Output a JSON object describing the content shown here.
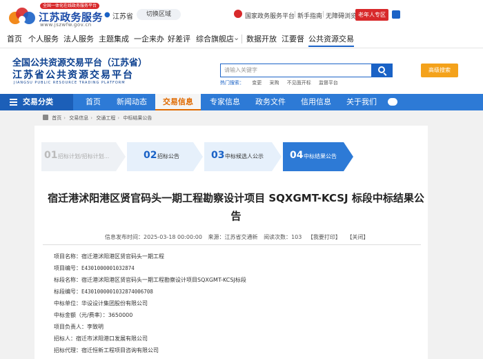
{
  "gov": {
    "site_name": "江苏政务服务",
    "slogan": "全国一体化在线政务服务平台",
    "url": "www.jszwfw.gov.cn",
    "location": "江苏省",
    "switch_region": "切换区域",
    "links": [
      "国家政务服务平台",
      "新手指南",
      "无障碍浏览"
    ],
    "elder_mode": "老年人专区",
    "nav": [
      "首页",
      "个人服务",
      "法人服务",
      "主题集成",
      "一企来办",
      "好差评",
      "综合旗舰店",
      "数据开放",
      "江要督",
      "公共资源交易"
    ],
    "nav_active": "公共资源交易"
  },
  "header": {
    "title_line1": "全国公共资源交易平台（江苏省）",
    "title_line2": "江苏省公共资源交易平台",
    "title_en": "JIANGSU PUBLIC RESOURCE TRADING PLATFORM",
    "search_placeholder": "请输入关键字",
    "hot_label": "热门搜索：",
    "hot_words": [
      "变更",
      "采购",
      "不见面开标",
      "监督平台"
    ],
    "adv_search": "高级搜索"
  },
  "mainnav": {
    "category": "交易分类",
    "items": [
      "首页",
      "新闻动态",
      "交易信息",
      "专家信息",
      "政务文件",
      "信用信息",
      "关于我们"
    ],
    "active": "交易信息"
  },
  "breadcrumb": [
    "首页",
    "交易信息",
    "交通工程",
    "中标结果公告"
  ],
  "steps": [
    {
      "num": "01",
      "label": "招标计划/招标计划..."
    },
    {
      "num": "02",
      "label": "招标公告"
    },
    {
      "num": "03",
      "label": "中标候选人公示"
    },
    {
      "num": "04",
      "label": "中标结果公告"
    }
  ],
  "article": {
    "title": "宿迁港沭阳港区贤官码头一期工程勘察设计项目 SQXGMT-KCSJ 标段中标结果公告",
    "publish_label": "信息发布时间：",
    "publish_time": "2025-03-18 00:00:00",
    "source_label": "来源：",
    "source": "江苏省交通新",
    "views_label": "阅读次数：",
    "views": "103",
    "print": "【我要打印】",
    "close": "【关闭】"
  },
  "fields": [
    {
      "label": "项目名称：",
      "value": "宿迁港沭阳港区贤官码头一期工程"
    },
    {
      "label": "项目编号：",
      "value": "E4301000001032874"
    },
    {
      "label": "标段名称：",
      "value": "宿迁港沭阳港区贤官码头一期工程勘察设计项目SQXGMT-KCSJ标段"
    },
    {
      "label": "标段编号：",
      "value": "E4301000001032874006708"
    },
    {
      "label": "中标单位：",
      "value": "华设设计集团股份有限公司"
    },
    {
      "label": "中标金额（元/费率）：",
      "value": "3650000"
    },
    {
      "label": "项目负责人：",
      "value": "李致明"
    },
    {
      "label": "招标人：",
      "value": "宿迁市沭阳港口发展有限公司"
    },
    {
      "label": "招标代理：",
      "value": "宿迁恒新工程项目咨询有限公司"
    }
  ]
}
